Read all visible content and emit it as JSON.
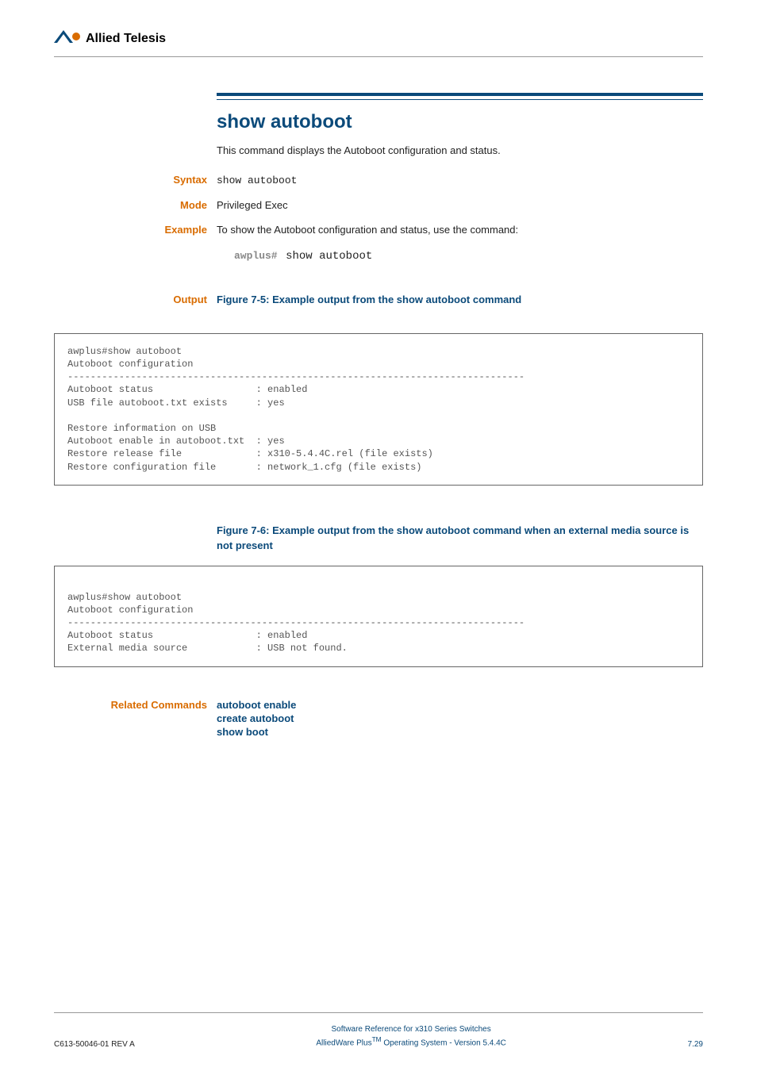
{
  "brand": {
    "company": "Allied Telesis"
  },
  "cmd": {
    "title": "show autoboot",
    "description": "This command displays the Autoboot configuration and status."
  },
  "labels": {
    "syntax": "Syntax",
    "mode": "Mode",
    "example": "Example",
    "output": "Output",
    "related": "Related Commands"
  },
  "syntax": {
    "text": "show autoboot"
  },
  "mode": {
    "text": "Privileged Exec"
  },
  "example": {
    "text": "To show the Autoboot configuration and status, use the command:",
    "prompt": "awplus#",
    "command": "show autoboot"
  },
  "figures": {
    "f75": "Figure 7-5: Example output from the show autoboot command",
    "f76": "Figure 7-6: Example output from the show autoboot command when an external media source is not present"
  },
  "output1": "awplus#show autoboot\nAutoboot configuration\n--------------------------------------------------------------------------------\nAutoboot status                  : enabled\nUSB file autoboot.txt exists     : yes\n\nRestore information on USB\nAutoboot enable in autoboot.txt  : yes\nRestore release file             : x310-5.4.4C.rel (file exists)\nRestore configuration file       : network_1.cfg (file exists)",
  "output2": "\nawplus#show autoboot\nAutoboot configuration\n--------------------------------------------------------------------------------\nAutoboot status                  : enabled\nExternal media source            : USB not found.",
  "related": {
    "link1": "autoboot enable",
    "link2": "create autoboot",
    "link3": "show boot"
  },
  "footer": {
    "left": "C613-50046-01 REV A",
    "center1": "Software Reference for x310 Series Switches",
    "center2_pre": "AlliedWare Plus",
    "center2_tm": "TM",
    "center2_post": " Operating System - Version 5.4.4C",
    "right": "7.29"
  }
}
